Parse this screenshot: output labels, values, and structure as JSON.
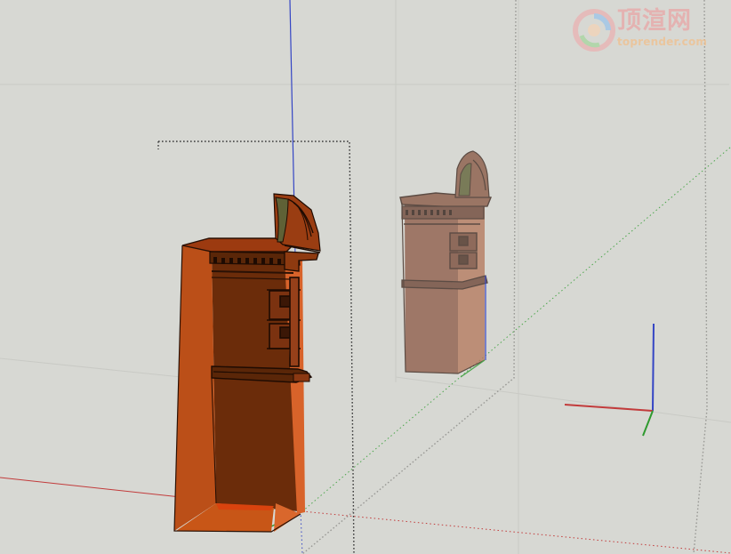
{
  "watermark": {
    "title": "顶渲网",
    "url": "toprender.com"
  },
  "colors": {
    "background": "#d7d8d3",
    "red_axis": "#c23b3b",
    "green_axis": "#4ca64c",
    "blue_axis": "#3445c4",
    "brick_front": "#a83f12",
    "brick_side": "#d4662a",
    "brick_shadow": "#5c2608",
    "brick_far": "#8f5d4a",
    "ornament_green": "#5f6136"
  },
  "icons": {
    "axes_gizmo": "axes-icon",
    "watermark_logo": "swirl-logo-icon"
  }
}
